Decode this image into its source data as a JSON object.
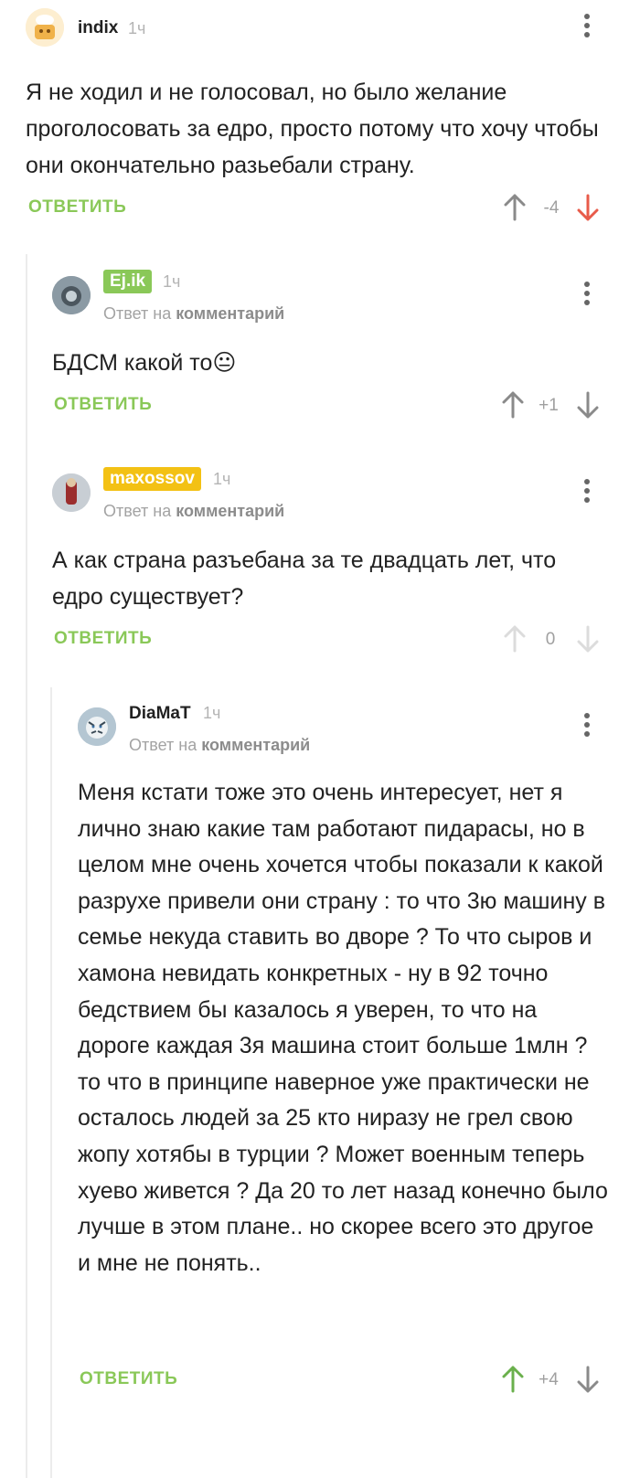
{
  "comments": [
    {
      "username": "indix",
      "time": "1ч",
      "text": "Я не ходил и не голосовал, но было желание проголосовать за едро, просто потому что хочу чтобы они окончательно разьебали страну.",
      "reply_label": "ОТВЕТИТЬ",
      "score": "-4",
      "colors": {
        "score": "#a0a0a0",
        "up": "#8a8a8a",
        "down": "#e85b4a"
      }
    },
    {
      "username": "Ej.ik",
      "badge_color": "#8ac858",
      "time": "1ч",
      "reply_to_prefix": "Ответ на",
      "reply_to_target": "комментарий",
      "text": "БДСМ какой то",
      "emoji": "😐",
      "reply_label": "ОТВЕТИТЬ",
      "score": "+1",
      "colors": {
        "score": "#a0a0a0",
        "up": "#8a8a8a",
        "down": "#8a8a8a"
      }
    },
    {
      "username": "maxossov",
      "badge_color": "#f3c114",
      "time": "1ч",
      "reply_to_prefix": "Ответ на",
      "reply_to_target": "комментарий",
      "text": "А как страна разъебана за те двадцать лет, что едро существует?",
      "reply_label": "ОТВЕТИТЬ",
      "score": "0",
      "colors": {
        "score": "#a0a0a0",
        "up": "#dcdcdc",
        "down": "#dcdcdc"
      }
    },
    {
      "username": "DiaMaT",
      "time": "1ч",
      "reply_to_prefix": "Ответ на",
      "reply_to_target": "комментарий",
      "text": "Меня кстати тоже это очень интересует, нет я лично знаю какие там работают пидарасы, но в целом мне очень хочется чтобы показали к какой разрухе привели они страну : то что 3ю машину в семье некуда ставить во дворе ? То что сыров и хамона невидать конкретных - ну в 92 точно бедствием бы казалось я уверен, то что на дороге каждая 3я машина стоит больше 1млн ? то что в принципе наверное уже практически не осталось людей за 25 кто ниразу не грел свою жопу хотябы в турции ? Может военным теперь хуево живется ? Да 20 то лет назад конечно было лучше в этом плане.. но скорее всего это другое и мне не понять..",
      "reply_label": "ОТВЕТИТЬ",
      "score": "+4",
      "colors": {
        "score": "#a0a0a0",
        "up": "#6ab04c",
        "down": "#8a8a8a"
      }
    }
  ],
  "icons": {
    "menu": "kebab-menu-icon",
    "upvote": "arrow-up-icon",
    "downvote": "arrow-down-icon"
  },
  "accent_color": "#8ac858"
}
